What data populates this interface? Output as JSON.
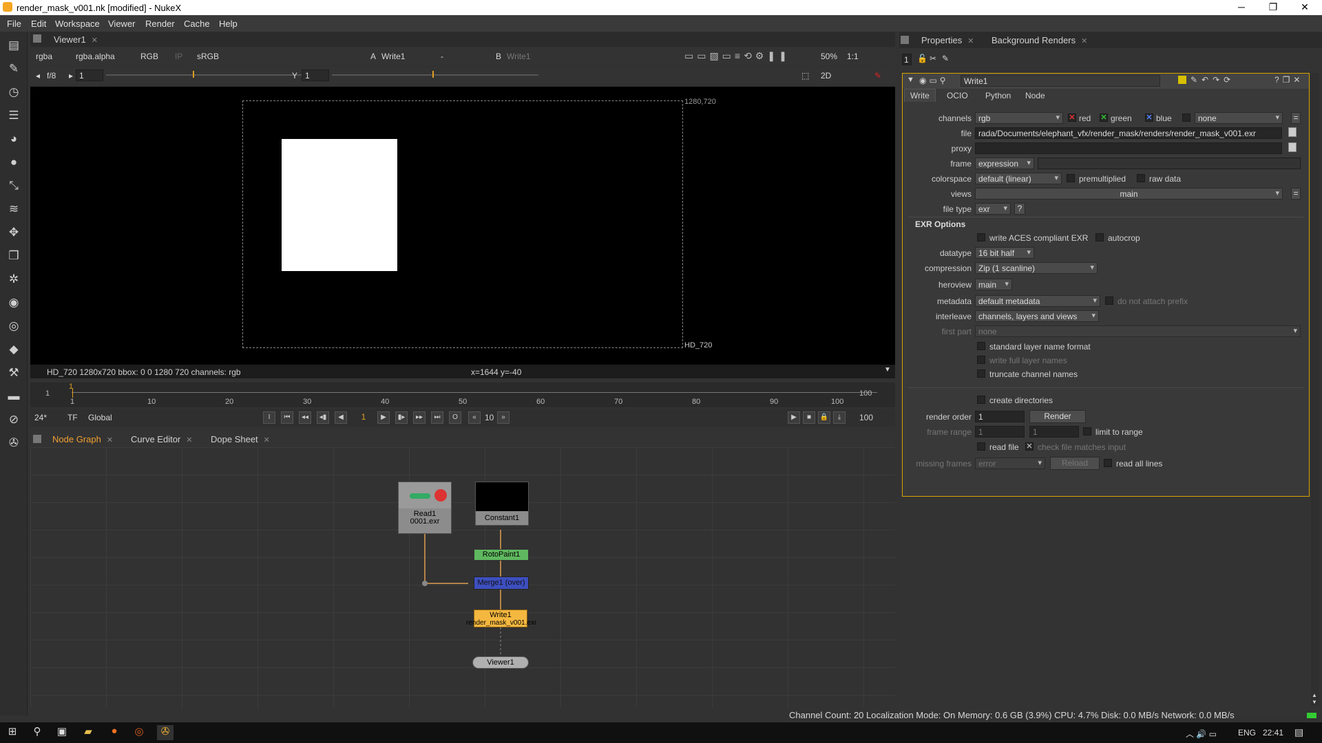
{
  "window": {
    "title": "render_mask_v001.nk [modified] - NukeX",
    "minimize": "─",
    "maximize": "❐",
    "close": "✕"
  },
  "menu": [
    "File",
    "Edit",
    "Workspace",
    "Viewer",
    "Render",
    "Cache",
    "Help"
  ],
  "viewer_tab": "Viewer1",
  "viewer_toolbar": {
    "channels": "rgba",
    "alpha": "rgba.alpha",
    "display": "RGB",
    "ip": "IP",
    "lut": "sRGB",
    "a_label": "A",
    "a_input": "Write1",
    "op": "-",
    "b_label": "B",
    "b_input": "Write1",
    "zoom": "50%",
    "ratio": "1:1",
    "view": "2D"
  },
  "viewer_row2": {
    "fstop": "f/8",
    "gain": "1",
    "y_label": "Y",
    "gamma": "1"
  },
  "viewer": {
    "format_tr": "1280,720",
    "format_br": "HD_720"
  },
  "viewer_status": {
    "left": "HD_720 1280x720  bbox: 0 0 1280 720 channels: rgb",
    "coords": "x=1644 y=-40"
  },
  "timeline": {
    "start": "1",
    "end": "100",
    "current_marker": "1",
    "ticks": [
      "1",
      "10",
      "20",
      "30",
      "40",
      "50",
      "60",
      "70",
      "80",
      "90",
      "100"
    ]
  },
  "transport": {
    "fps": "24*",
    "tf": "TF",
    "scope": "Global",
    "frame": "1",
    "step": "10",
    "end_frame": "100"
  },
  "graph_tabs": [
    "Node Graph",
    "Curve Editor",
    "Dope Sheet"
  ],
  "nodes": {
    "read": {
      "name": "Read1",
      "file": "0001.exr"
    },
    "constant": {
      "name": "Constant1"
    },
    "roto": {
      "name": "RotoPaint1"
    },
    "merge": {
      "name": "Merge1 (over)"
    },
    "write": {
      "name": "Write1",
      "file": "render_mask_v001.exr"
    },
    "viewer": {
      "name": "Viewer1"
    }
  },
  "props_tabs": [
    "Properties",
    "Background Renders"
  ],
  "props_count": "1",
  "write_panel": {
    "node_name": "Write1",
    "tabs": [
      "Write",
      "OCIO",
      "Python",
      "Node"
    ],
    "channels": "rgb",
    "ch_red": "red",
    "ch_green": "green",
    "ch_blue": "blue",
    "ch_extra": "none",
    "file": "rada/Documents/elephant_vfx/render_mask/renders/render_mask_v001.exr",
    "proxy": "",
    "frame": "expression",
    "colorspace": "default (linear)",
    "premultiplied": "premultiplied",
    "raw_data": "raw data",
    "views": "main",
    "file_type": "exr",
    "help": "?",
    "exr_options": "EXR Options",
    "aces": "write ACES compliant EXR",
    "autocrop": "autocrop",
    "datatype": "16 bit half",
    "compression": "Zip (1 scanline)",
    "heroview": "main",
    "metadata": "default metadata",
    "no_prefix": "do not attach prefix",
    "interleave": "channels, layers and views",
    "first_part": "none",
    "std_layer": "standard layer name format",
    "full_layer": "write full layer names",
    "truncate": "truncate channel names",
    "create_dirs": "create directories",
    "render_order": "1",
    "render_btn": "Render",
    "range_start": "1",
    "range_end": "1",
    "limit": "limit to range",
    "read_file": "read file",
    "check_file": "check file matches input",
    "missing": "error",
    "reload": "Reload",
    "read_all": "read all lines"
  },
  "labels": {
    "channels": "channels",
    "file": "file",
    "proxy": "proxy",
    "frame": "frame",
    "colorspace": "colorspace",
    "views": "views",
    "file_type": "file type",
    "datatype": "datatype",
    "compression": "compression",
    "heroview": "heroview",
    "metadata": "metadata",
    "interleave": "interleave",
    "first_part": "first part",
    "render_order": "render order",
    "frame_range": "frame range",
    "missing_frames": "missing frames"
  },
  "app_status": "Channel Count: 20 Localization Mode: On Memory: 0.6 GB (3.9%) CPU: 4.7% Disk: 0.0 MB/s Network: 0.0 MB/s",
  "taskbar": {
    "lang": "ENG",
    "time": "22:41"
  }
}
